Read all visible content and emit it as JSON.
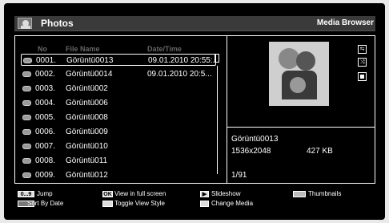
{
  "header": {
    "title": "Photos",
    "right_label": "Media Browser"
  },
  "columns": {
    "no": "No",
    "file_name": "File Name",
    "date_time": "Date/Time"
  },
  "rows": [
    {
      "no": "0001.",
      "name": "Görüntü0013",
      "date": "09.01.2010 20:55:.",
      "selected": true
    },
    {
      "no": "0002.",
      "name": "Görüntü0014",
      "date": "09.01.2010 20:5..."
    },
    {
      "no": "0003.",
      "name": "Görüntü002",
      "date": ""
    },
    {
      "no": "0004.",
      "name": "Görüntü006",
      "date": ""
    },
    {
      "no": "0005.",
      "name": "Görüntü008",
      "date": ""
    },
    {
      "no": "0006.",
      "name": "Görüntü009",
      "date": ""
    },
    {
      "no": "0007.",
      "name": "Görüntü010",
      "date": ""
    },
    {
      "no": "0008.",
      "name": "Görüntü011",
      "date": ""
    },
    {
      "no": "0009.",
      "name": "Görüntü012",
      "date": ""
    }
  ],
  "details": {
    "file_name": "Görüntü0013",
    "resolution": "1536x2048",
    "size": "427 KB",
    "position": "1/91"
  },
  "side_icons": [
    "repeat-icon",
    "shuffle-icon",
    "stop-icon"
  ],
  "footer": {
    "jump_key": "0...9",
    "jump": "Jump",
    "sort": "Sort By Date",
    "ok_key": "OK",
    "fullscreen": "View in full screen",
    "toggle": "Toggle View Style",
    "play_key": "▶",
    "slideshow": "Slideshow",
    "change_media": "Change Media",
    "thumbnails": "Thumbnails"
  },
  "colors": {
    "background": "#000000",
    "header": "#3a3a3a",
    "text": "#ffffff",
    "column_header": "#666666"
  }
}
